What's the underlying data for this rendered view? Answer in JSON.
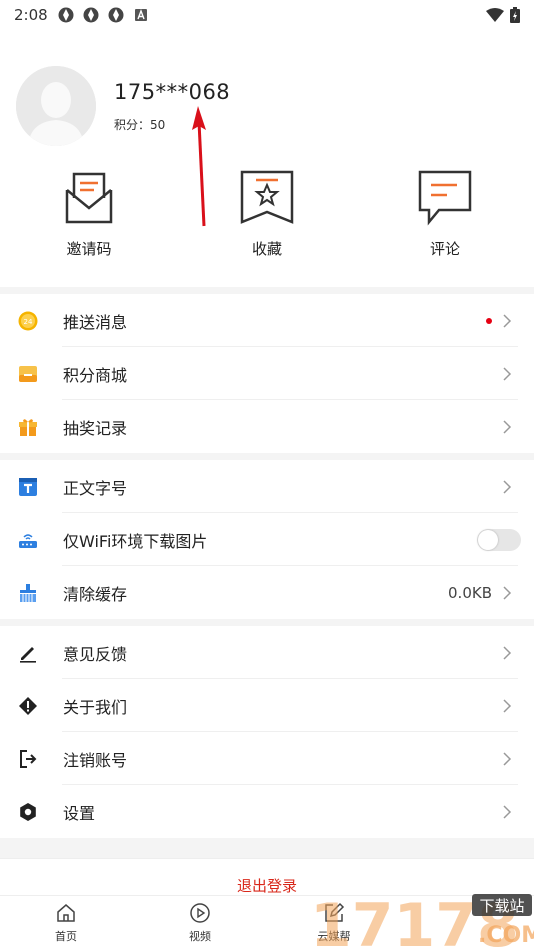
{
  "status_bar": {
    "time": "2:08",
    "icons": [
      "app-icon",
      "app-icon",
      "app-icon",
      "a-icon"
    ],
    "right_icons": [
      "wifi-icon",
      "battery-icon"
    ]
  },
  "profile": {
    "phone": "175***068",
    "score": "积分：50"
  },
  "actions": [
    {
      "label": "邀请码",
      "icon": "invite-envelope-icon"
    },
    {
      "label": "收藏",
      "icon": "favorite-star-icon"
    },
    {
      "label": "评论",
      "icon": "comment-icon"
    }
  ],
  "menu": {
    "push": {
      "label": "推送消息",
      "icon": "push-message-icon",
      "has_badge_dot": true
    },
    "mall": {
      "label": "积分商城",
      "icon": "points-mall-icon"
    },
    "lottery": {
      "label": "抽奖记录",
      "icon": "gift-icon"
    },
    "font": {
      "label": "正文字号",
      "icon": "font-size-icon"
    },
    "wifi": {
      "label": "仅WiFi环境下载图片",
      "icon": "router-icon",
      "toggle_on": false
    },
    "cache": {
      "label": "清除缓存",
      "value": "0.0KB",
      "icon": "broom-icon"
    },
    "feedback": {
      "label": "意见反馈",
      "icon": "pencil-icon"
    },
    "about": {
      "label": "关于我们",
      "icon": "info-diamond-icon"
    },
    "cancel": {
      "label": "注销账号",
      "icon": "sign-out-icon"
    },
    "settings": {
      "label": "设置",
      "icon": "gear-icon"
    }
  },
  "logout_label": "退出登录",
  "tabs": [
    {
      "label": "首页",
      "icon": "home-icon"
    },
    {
      "label": "视频",
      "icon": "play-icon"
    },
    {
      "label": "云媒帮",
      "icon": "edit-icon"
    }
  ],
  "watermark": {
    "brand": "17178",
    "sub": "下载站",
    "domain": ".COM"
  },
  "colors": {
    "accent_orange": "#f5a623",
    "arrow_red": "#d9101a",
    "logout_red": "#d9281b",
    "font_blue": "#2d7fe0"
  }
}
